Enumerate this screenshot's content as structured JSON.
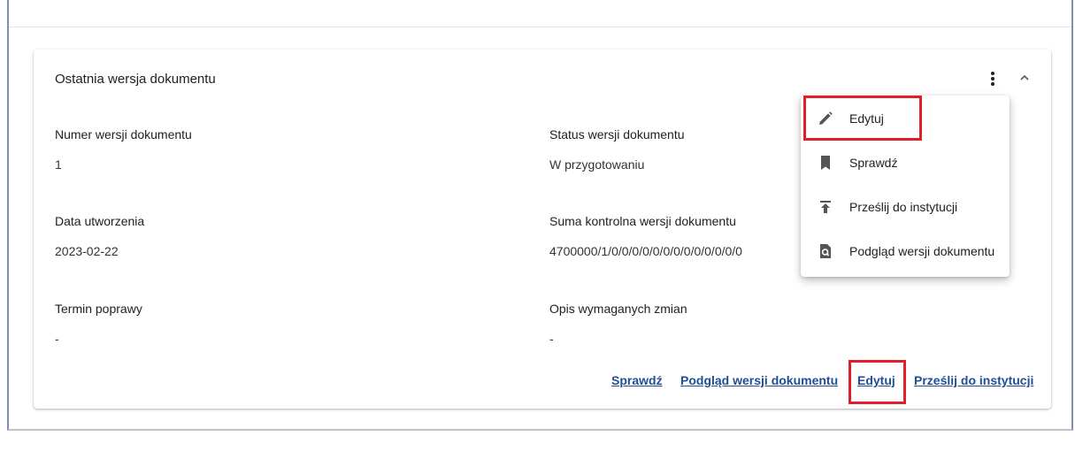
{
  "card": {
    "title": "Ostatnia wersja dokumentu",
    "fields": [
      {
        "label": "Numer wersji dokumentu",
        "value": "1"
      },
      {
        "label": "Status wersji dokumentu",
        "value": "W przygotowaniu"
      },
      {
        "label": "Data utworzenia",
        "value": "2023-02-22"
      },
      {
        "label": "Suma kontrolna wersji dokumentu",
        "value": "4700000/1/0/0/0/0/0/0/0/0/0/0/0/0/0"
      },
      {
        "label": "Termin poprawy",
        "value": "-"
      },
      {
        "label": "Opis wymaganych zmian",
        "value": "-"
      }
    ],
    "actions": {
      "check": "Sprawdź",
      "preview": "Podgląd wersji dokumentu",
      "edit": "Edytuj",
      "send": "Prześlij do instytucji"
    }
  },
  "menu": {
    "items": [
      {
        "label": "Edytuj",
        "icon": "pencil-icon"
      },
      {
        "label": "Sprawdź",
        "icon": "bookmark-icon"
      },
      {
        "label": "Prześlij do instytucji",
        "icon": "upload-icon"
      },
      {
        "label": "Podgląd wersji dokumentu",
        "icon": "document-search-icon"
      }
    ]
  },
  "colors": {
    "link": "#1f4e97",
    "highlight": "#e01f2a",
    "frame": "#7f8fb8"
  }
}
